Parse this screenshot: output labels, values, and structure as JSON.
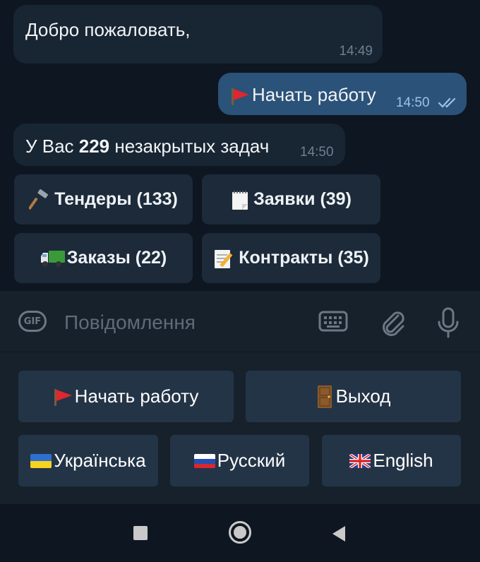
{
  "chat": {
    "messages": [
      {
        "text": "Добро пожаловать,",
        "time": "14:49",
        "direction": "in"
      },
      {
        "text": "Начать работу",
        "time": "14:50",
        "direction": "out",
        "icon": "red-flag-icon",
        "read_status": "double-check-icon"
      },
      {
        "text_pre": "У Вас ",
        "text_bold": "229",
        "text_post": " незакрытых задач",
        "time": "14:50",
        "direction": "in"
      }
    ],
    "inline_buttons": [
      {
        "label": "Тендеры (133)",
        "icon": "hammer-icon"
      },
      {
        "label": "Заявки (39)",
        "icon": "notepad-icon"
      },
      {
        "label": "Заказы (22)",
        "icon": "truck-icon"
      },
      {
        "label": "Контракты (35)",
        "icon": "memo-icon"
      }
    ]
  },
  "input": {
    "placeholder": "Повідомлення",
    "gif_label": "GIF"
  },
  "keyboard": {
    "row1": [
      {
        "label": "Начать работу",
        "icon": "red-flag-icon"
      },
      {
        "label": "Выход",
        "icon": "door-icon"
      }
    ],
    "row2": [
      {
        "label": "Українська",
        "icon": "ukraine-flag-icon"
      },
      {
        "label": "Русский",
        "icon": "russia-flag-icon"
      },
      {
        "label": "English",
        "icon": "uk-flag-icon"
      }
    ]
  },
  "colors": {
    "background": "#0e1621",
    "incoming_bubble": "#182533",
    "outgoing_bubble": "#2b5278",
    "panel": "#17212b",
    "keyboard_button": "#243447"
  }
}
